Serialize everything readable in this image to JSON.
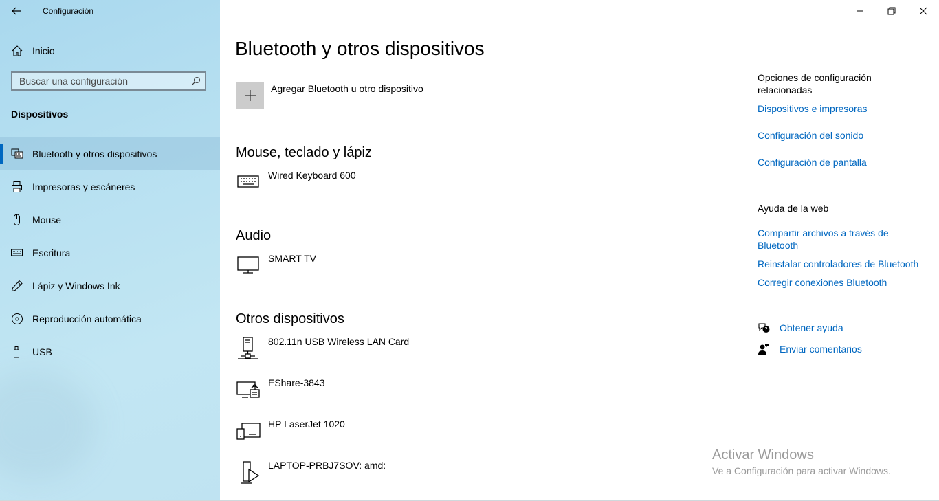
{
  "window": {
    "title": "Configuración",
    "back_glyph": "←"
  },
  "sidebar": {
    "home_label": "Inicio",
    "search_placeholder": "Buscar una configuración",
    "section_title": "Dispositivos",
    "items": [
      {
        "label": "Bluetooth y otros dispositivos",
        "icon": "bluetooth-devices-icon",
        "selected": true
      },
      {
        "label": "Impresoras y escáneres",
        "icon": "printer-icon"
      },
      {
        "label": "Mouse",
        "icon": "mouse-icon"
      },
      {
        "label": "Escritura",
        "icon": "keyboard-icon"
      },
      {
        "label": "Lápiz y Windows Ink",
        "icon": "pen-icon"
      },
      {
        "label": "Reproducción automática",
        "icon": "autoplay-icon"
      },
      {
        "label": "USB",
        "icon": "usb-icon"
      }
    ]
  },
  "main": {
    "title": "Bluetooth y otros dispositivos",
    "add_label": "Agregar Bluetooth u otro dispositivo",
    "groups": [
      {
        "title": "Mouse, teclado y lápiz",
        "devices": [
          {
            "name": "Wired Keyboard 600",
            "icon": "keyboard-device-icon"
          }
        ]
      },
      {
        "title": "Audio",
        "devices": [
          {
            "name": "SMART TV",
            "icon": "monitor-device-icon"
          }
        ]
      },
      {
        "title": "Otros dispositivos",
        "devices": [
          {
            "name": "802.11n USB Wireless LAN Card",
            "icon": "network-adapter-icon"
          },
          {
            "name": "EShare-3843",
            "icon": "wireless-display-icon"
          },
          {
            "name": "HP LaserJet 1020",
            "icon": "printer-device-icon"
          },
          {
            "name": "LAPTOP-PRBJ7SOV: amd:",
            "icon": "media-device-icon"
          }
        ]
      }
    ]
  },
  "related": {
    "heading": "Opciones de configuración relacionadas",
    "links": [
      "Dispositivos e impresoras",
      "Configuración del sonido",
      "Configuración de pantalla"
    ]
  },
  "web_help": {
    "heading": "Ayuda de la web",
    "links": [
      "Compartir archivos a través de Bluetooth",
      "Reinstalar controladores de Bluetooth",
      "Corregir conexiones Bluetooth"
    ]
  },
  "help": {
    "get_help": "Obtener ayuda",
    "feedback": "Enviar comentarios"
  },
  "watermark": {
    "title": "Activar Windows",
    "subtitle": "Ve a Configuración para activar Windows."
  },
  "colors": {
    "accent": "#0067c0",
    "sidebar": "#b7e0f1"
  }
}
